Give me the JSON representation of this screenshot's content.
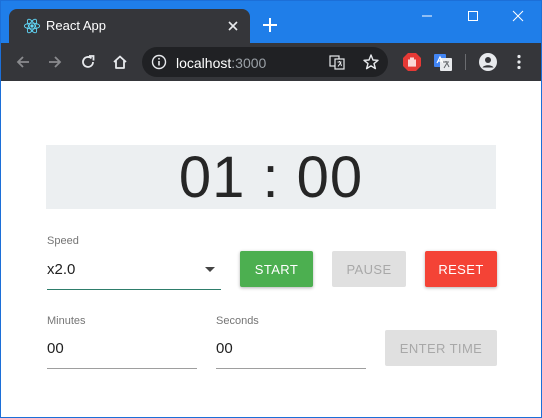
{
  "browser": {
    "tab_title": "React App",
    "url_host": "localhost",
    "url_port": ":3000"
  },
  "timer": {
    "display": "01 : 00"
  },
  "speed": {
    "label": "Speed",
    "value": "x2.0"
  },
  "buttons": {
    "start": "START",
    "pause": "PAUSE",
    "reset": "RESET",
    "enter_time": "ENTER TIME"
  },
  "minutes": {
    "label": "Minutes",
    "value": "00"
  },
  "seconds": {
    "label": "Seconds",
    "value": "00"
  },
  "colors": {
    "titlebar": "#1f7ee9",
    "toolbar": "#35363a",
    "start": "#4caf50",
    "reset": "#f44336",
    "disabled": "#e0e0e0",
    "timer_bg": "#eceff1"
  }
}
